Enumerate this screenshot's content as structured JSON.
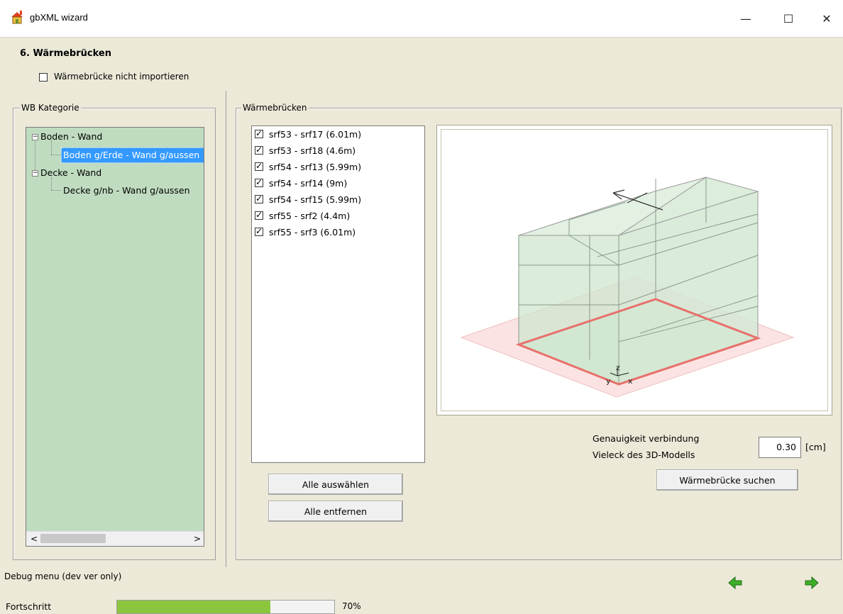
{
  "window": {
    "title": "gbXML wizard",
    "minimize_glyph": "—",
    "maximize_glyph": "☐",
    "close_glyph": "✕"
  },
  "step": {
    "title": "6.  Wärmebrücken",
    "skip_label": "Wärmebrücke nicht importieren",
    "skip_checked": false
  },
  "wb_kategorie": {
    "legend": "WB Kategorie",
    "tree": [
      {
        "label": "Boden - Wand",
        "expanded": true,
        "children": [
          {
            "label": "Boden g/Erde - Wand g/aussen",
            "selected": true
          }
        ]
      },
      {
        "label": "Decke - Wand",
        "expanded": true,
        "children": [
          {
            "label": "Decke g/nb - Wand g/aussen",
            "selected": false
          }
        ]
      }
    ],
    "scroll_left": "<",
    "scroll_right": ">"
  },
  "waermebruecken": {
    "legend": "Wärmebrücken",
    "items": [
      {
        "label": "srf53 - srf17 (6.01m)",
        "checked": true
      },
      {
        "label": "srf53 - srf18 (4.6m)",
        "checked": true
      },
      {
        "label": "srf54 - srf13 (5.99m)",
        "checked": true
      },
      {
        "label": "srf54 - srf14 (9m)",
        "checked": true
      },
      {
        "label": "srf54 - srf15 (5.99m)",
        "checked": true
      },
      {
        "label": "srf55 - srf2 (4.4m)",
        "checked": true
      },
      {
        "label": "srf55 - srf3 (6.01m)",
        "checked": true
      }
    ],
    "select_all_label": "Alle auswählen",
    "remove_all_label": "Alle entfernen",
    "axis_labels": {
      "z": "z",
      "y": "y",
      "x": "x"
    }
  },
  "accuracy": {
    "line1": "Genauigkeit verbindung",
    "line2": "Vieleck des 3D-Modells",
    "value": "0.30",
    "unit": "[cm]"
  },
  "search_button_label": "Wärmebrücke suchen",
  "debug_label": "Debug menu (dev ver only)",
  "progress": {
    "label": "Fortschritt",
    "value_text": "70%",
    "fraction": 0.7
  },
  "colors": {
    "tree_background": "#c0dcc0",
    "selection": "#3399ff",
    "progress_fill": "#8cc63f",
    "nav_arrow": "#3fae29",
    "highlight_edge": "#e8706a"
  },
  "icons": {
    "app": "house-icon",
    "back": "arrow-left-icon",
    "next": "arrow-right-icon"
  }
}
